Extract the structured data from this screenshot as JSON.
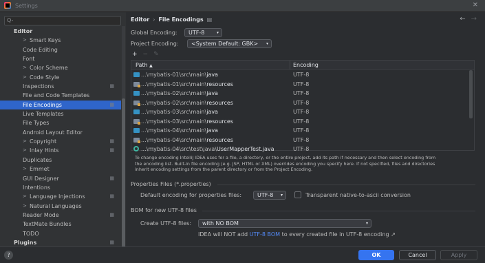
{
  "window": {
    "title": "Settings"
  },
  "sidebar": {
    "search_placeholder": "Q-",
    "items": [
      {
        "label": "Editor",
        "kind": "section"
      },
      {
        "label": "Smart Keys",
        "kind": "exp",
        "arrow": ">"
      },
      {
        "label": "Code Editing",
        "kind": "sub"
      },
      {
        "label": "Font",
        "kind": "sub"
      },
      {
        "label": "Color Scheme",
        "kind": "exp",
        "arrow": ">"
      },
      {
        "label": "Code Style",
        "kind": "exp",
        "arrow": ">"
      },
      {
        "label": "Inspections",
        "kind": "sub",
        "badge": "▦"
      },
      {
        "label": "File and Code Templates",
        "kind": "sub"
      },
      {
        "label": "File Encodings",
        "kind": "sub",
        "badge": "▦",
        "selected": true
      },
      {
        "label": "Live Templates",
        "kind": "sub"
      },
      {
        "label": "File Types",
        "kind": "sub"
      },
      {
        "label": "Android Layout Editor",
        "kind": "sub"
      },
      {
        "label": "Copyright",
        "kind": "exp",
        "arrow": ">",
        "badge": "▦"
      },
      {
        "label": "Inlay Hints",
        "kind": "exp",
        "arrow": ">",
        "badge": "▦"
      },
      {
        "label": "Duplicates",
        "kind": "sub"
      },
      {
        "label": "Emmet",
        "kind": "exp",
        "arrow": ">"
      },
      {
        "label": "GUI Designer",
        "kind": "sub",
        "badge": "▦"
      },
      {
        "label": "Intentions",
        "kind": "sub"
      },
      {
        "label": "Language Injections",
        "kind": "exp",
        "arrow": ">",
        "badge": "▦"
      },
      {
        "label": "Natural Languages",
        "kind": "exp",
        "arrow": ">"
      },
      {
        "label": "Reader Mode",
        "kind": "sub",
        "badge": "▦"
      },
      {
        "label": "TextMate Bundles",
        "kind": "sub"
      },
      {
        "label": "TODO",
        "kind": "sub"
      },
      {
        "label": "Plugins",
        "kind": "section",
        "badge": "▦"
      }
    ]
  },
  "header": {
    "breadcrumb_root": "Editor",
    "breadcrumb_sep": "›",
    "breadcrumb_current": "File Encodings",
    "breadcrumb_icon": "▤",
    "back": "←",
    "forward": "→"
  },
  "global_encoding": {
    "label": "Global Encoding:",
    "value": "UTF-8"
  },
  "project_encoding": {
    "label": "Project Encoding:",
    "value": "<System Default: GBK>"
  },
  "toolbar": {
    "add": "+",
    "remove": "−",
    "edit": "✎"
  },
  "table": {
    "columns": {
      "path": "Path",
      "sort": "▲",
      "encoding": "Encoding"
    },
    "rows": [
      {
        "prefix": "...\\mybatis-01\\src\\main\\",
        "tail": "java",
        "encoding": "UTF-8",
        "icon": "src"
      },
      {
        "prefix": "...\\mybatis-01\\src\\main\\",
        "tail": "resources",
        "encoding": "UTF-8",
        "icon": "res"
      },
      {
        "prefix": "...\\mybatis-02\\src\\main\\",
        "tail": "java",
        "encoding": "UTF-8",
        "icon": "src"
      },
      {
        "prefix": "...\\mybatis-02\\src\\main\\",
        "tail": "resources",
        "encoding": "UTF-8",
        "icon": "res"
      },
      {
        "prefix": "...\\mybatis-03\\src\\main\\",
        "tail": "java",
        "encoding": "UTF-8",
        "icon": "src"
      },
      {
        "prefix": "...\\mybatis-03\\src\\main\\",
        "tail": "resources",
        "encoding": "UTF-8",
        "icon": "res"
      },
      {
        "prefix": "...\\mybatis-04\\src\\main\\",
        "tail": "java",
        "encoding": "UTF-8",
        "icon": "src"
      },
      {
        "prefix": "...\\mybatis-04\\src\\main\\",
        "tail": "resources",
        "encoding": "UTF-8",
        "icon": "res"
      },
      {
        "prefix": "...\\mybatis-04\\src\\test\\java\\",
        "tail": "UserMapperTest.java",
        "encoding": "UTF-8",
        "icon": "test"
      }
    ]
  },
  "help_text": {
    "line1": "To change encoding IntelliJ IDEA uses for a file, a directory, or the entire project, add its path if necessary and then select encoding from",
    "line2": "the encoding list. Built-in file encoding (e.g. JSP, HTML or XML) overrides encoding you specify here. If not specified, files and directories",
    "line3": "inherit encoding settings from the parent directory or from the Project Encoding."
  },
  "properties": {
    "title": "Properties Files (*.properties)",
    "default_label": "Default encoding for properties files:",
    "default_value": "UTF-8",
    "transparent_label": "Transparent native-to-ascii conversion"
  },
  "bom": {
    "title": "BOM for new UTF-8 files",
    "create_label": "Create UTF-8 files:",
    "create_value": "with NO BOM",
    "note_prefix": "IDEA will NOT add",
    "note_link": "UTF-8 BOM",
    "note_suffix": "to every created file in UTF-8 encoding ↗"
  },
  "footer": {
    "help": "?",
    "ok": "OK",
    "cancel": "Cancel",
    "apply": "Apply"
  },
  "icons": {
    "caret": "▾",
    "close": "✕"
  }
}
